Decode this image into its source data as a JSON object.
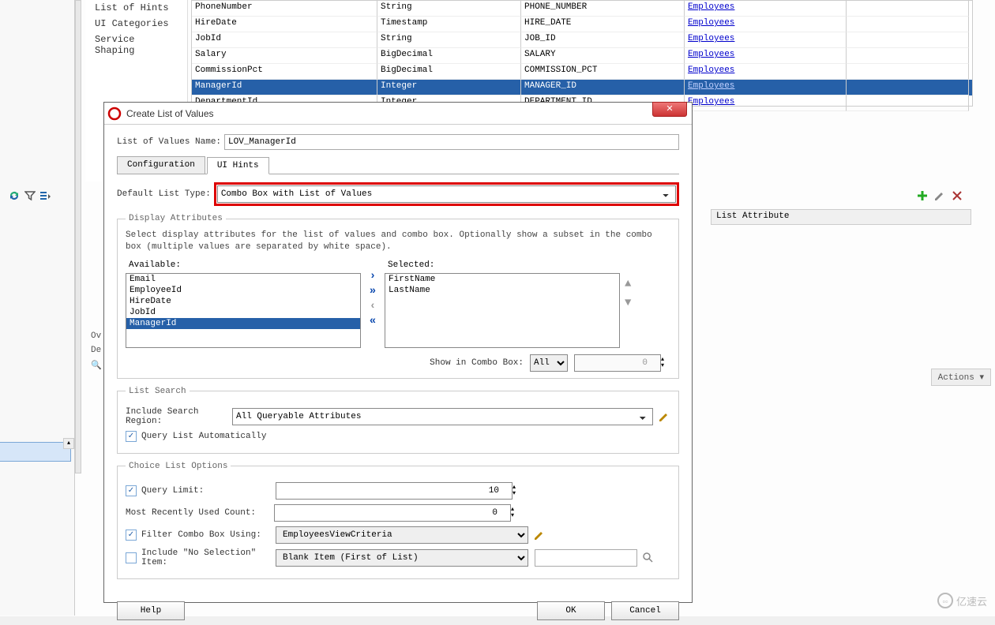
{
  "sidebar": {
    "items": [
      "List of Hints",
      "UI Categories",
      "Service Shaping"
    ]
  },
  "table": {
    "rows": [
      {
        "name": "PhoneNumber",
        "type": "String",
        "col": "PHONE_NUMBER",
        "link": "Employees"
      },
      {
        "name": "HireDate",
        "type": "Timestamp",
        "col": "HIRE_DATE",
        "link": "Employees"
      },
      {
        "name": "JobId",
        "type": "String",
        "col": "JOB_ID",
        "link": "Employees"
      },
      {
        "name": "Salary",
        "type": "BigDecimal",
        "col": "SALARY",
        "link": "Employees"
      },
      {
        "name": "CommissionPct",
        "type": "BigDecimal",
        "col": "COMMISSION_PCT",
        "link": "Employees"
      },
      {
        "name": "ManagerId",
        "type": "Integer",
        "col": "MANAGER_ID",
        "link": "Employees",
        "selected": true
      },
      {
        "name": "DepartmentId",
        "type": "Integer",
        "col": "DEPARTMENT_ID",
        "link": "Employees"
      }
    ],
    "list_attr_header": "List Attribute"
  },
  "actions_label": "Actions",
  "left_labels": {
    "ov": "Ov",
    "de": "De",
    "search": ""
  },
  "dialog": {
    "title": "Create List of Values",
    "lov_name_label": "List of Values Name:",
    "lov_name_value": "LOV_ManagerId",
    "tabs": {
      "config": "Configuration",
      "uihints": "UI Hints"
    },
    "default_list_type_label": "Default List Type:",
    "default_list_type_value": "Combo Box with List of Values",
    "display_attrs": {
      "legend": "Display Attributes",
      "hint": "Select display attributes for the list of values and combo box. Optionally show a subset in the combo box (multiple values are separated by white space).",
      "available_label": "Available:",
      "available": [
        "Email",
        "EmployeeId",
        "HireDate",
        "JobId",
        "ManagerId"
      ],
      "selected_label": "Selected:",
      "selected": [
        "FirstName",
        "LastName"
      ],
      "show_combo_label": "Show in Combo Box:",
      "show_combo_value": "All",
      "show_combo_num": "0"
    },
    "list_search": {
      "legend": "List Search",
      "include_label": "Include Search Region:",
      "include_value": "All Queryable Attributes",
      "query_auto_label": "Query List Automatically"
    },
    "choice": {
      "legend": "Choice List Options",
      "query_limit_label": "Query Limit:",
      "query_limit_value": "10",
      "mru_label": "Most Recently Used Count:",
      "mru_value": "0",
      "filter_label": "Filter Combo Box Using:",
      "filter_value": "EmployeesViewCriteria",
      "nosel_label": "Include \"No Selection\" Item:",
      "nosel_value": "Blank Item (First of List)"
    },
    "buttons": {
      "help": "Help",
      "ok": "OK",
      "cancel": "Cancel"
    }
  },
  "watermark": "亿速云"
}
